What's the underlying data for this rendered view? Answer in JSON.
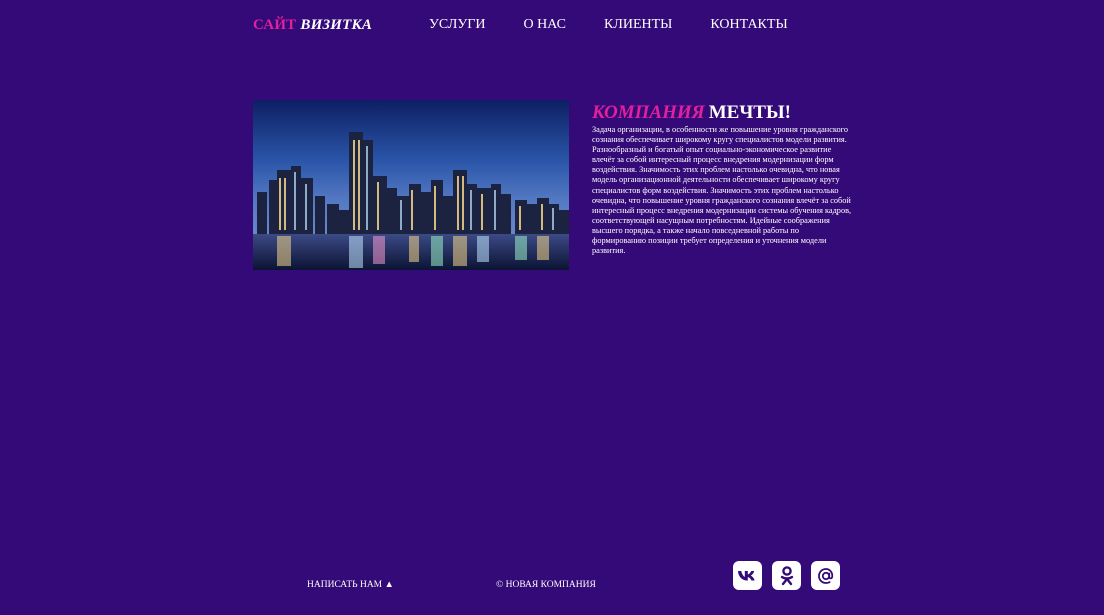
{
  "header": {
    "logo_accent": "САЙТ",
    "logo_rest": "ВИЗИТКА",
    "nav": [
      {
        "label": "УСЛУГИ"
      },
      {
        "label": "О НАС"
      },
      {
        "label": "КЛИЕНТЫ"
      },
      {
        "label": "КОНТАКТЫ"
      }
    ]
  },
  "main": {
    "title_accent": "КОМПАНИЯ",
    "title_rest": "МЕЧТЫ!",
    "text": "Задача организации, в особенности же повышение уровня гражданского сознания обеспечивает широкому кругу специалистов модели развития. Разнообразный и богатый опыт социально-экономическое развитие влечёт за собой интересный процесс внедрения модернизации форм воздействия. Значимость этих проблем настолько очевидна, что новая модель организационной деятельности обеспечивает широкому кругу специалистов форм воздействия. Значимость этих проблем настолько очевидна, что повышение уровня гражданского сознания влечёт за собой интересный процесс внедрения модернизации системы обучения кадров, соответствующей насущным потребностям. Идейные соображения высшего порядка, а также начало повседневной работы по формированию позиции требует определения и уточнения модели развития."
  },
  "footer": {
    "write_us": "НАПИСАТЬ НАМ ▲",
    "copyright": "© НОВАЯ КОМПАНИЯ",
    "socials": [
      {
        "icon": "vk-icon"
      },
      {
        "icon": "odnoklassniki-icon"
      },
      {
        "icon": "mail-at-icon"
      }
    ]
  },
  "colors": {
    "background": "#340a78",
    "accent": "#e0209c",
    "text": "#ffffff"
  }
}
